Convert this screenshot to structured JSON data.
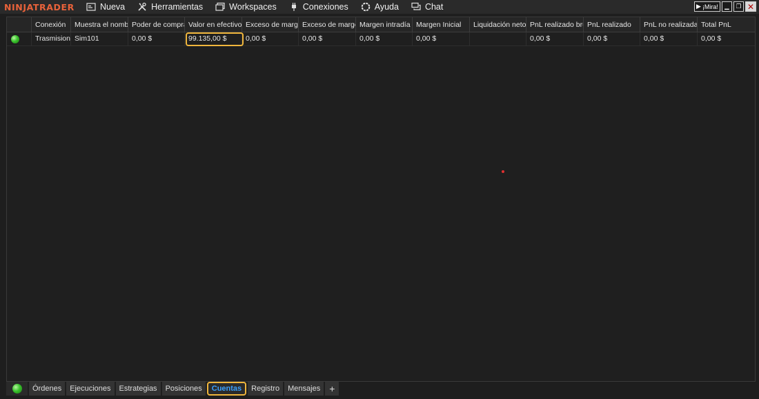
{
  "app": {
    "logo": "NINJATRADER"
  },
  "menu": [
    {
      "label": "Nueva",
      "icon": "new-window-icon"
    },
    {
      "label": "Herramientas",
      "icon": "tools-icon"
    },
    {
      "label": "Workspaces",
      "icon": "workspaces-icon"
    },
    {
      "label": "Conexiones",
      "icon": "plug-icon"
    },
    {
      "label": "Ayuda",
      "icon": "help-lifebuoy-icon"
    },
    {
      "label": "Chat",
      "icon": "chat-icon"
    }
  ],
  "window_controls": {
    "watch_label": "¡Mira!"
  },
  "grid": {
    "columns": [
      {
        "label": "",
        "width": 36
      },
      {
        "label": "Conexión",
        "width": 57
      },
      {
        "label": "Muestra el nomb",
        "width": 83
      },
      {
        "label": "Poder de compra",
        "width": 82
      },
      {
        "label": "Valor en efectivo",
        "width": 83
      },
      {
        "label": "Exceso de marge",
        "width": 82
      },
      {
        "label": "Exceso de marge",
        "width": 83
      },
      {
        "label": "Margen intradía",
        "width": 82
      },
      {
        "label": "Margen Inicial",
        "width": 83
      },
      {
        "label": "Liquidación neto",
        "width": 82
      },
      {
        "label": "PnL realizado bru",
        "width": 83
      },
      {
        "label": "PnL realizado",
        "width": 82
      },
      {
        "label": "PnL no realizadas",
        "width": 83
      },
      {
        "label": "Total PnL",
        "width": 82
      }
    ],
    "rows": [
      {
        "status": "connected",
        "cells": [
          "",
          "Trasmision",
          "Sim101",
          "0,00 $",
          "99.135,00 $",
          "0,00 $",
          "0,00 $",
          "0,00 $",
          "0,00 $",
          "",
          "0,00 $",
          "0,00 $",
          "0,00 $",
          "0,00 $"
        ]
      }
    ]
  },
  "tabs": [
    {
      "label": "Órdenes",
      "active": false
    },
    {
      "label": "Ejecuciones",
      "active": false
    },
    {
      "label": "Estrategias",
      "active": false
    },
    {
      "label": "Posiciones",
      "active": false
    },
    {
      "label": "Cuentas",
      "active": true
    },
    {
      "label": "Registro",
      "active": false
    },
    {
      "label": "Mensajes",
      "active": false
    }
  ],
  "add_tab_label": "+",
  "colors": {
    "accent": "#e8623a",
    "highlight": "#f0b63c",
    "active_tab_text": "#3aa0ff",
    "status_green": "#39c22c"
  }
}
